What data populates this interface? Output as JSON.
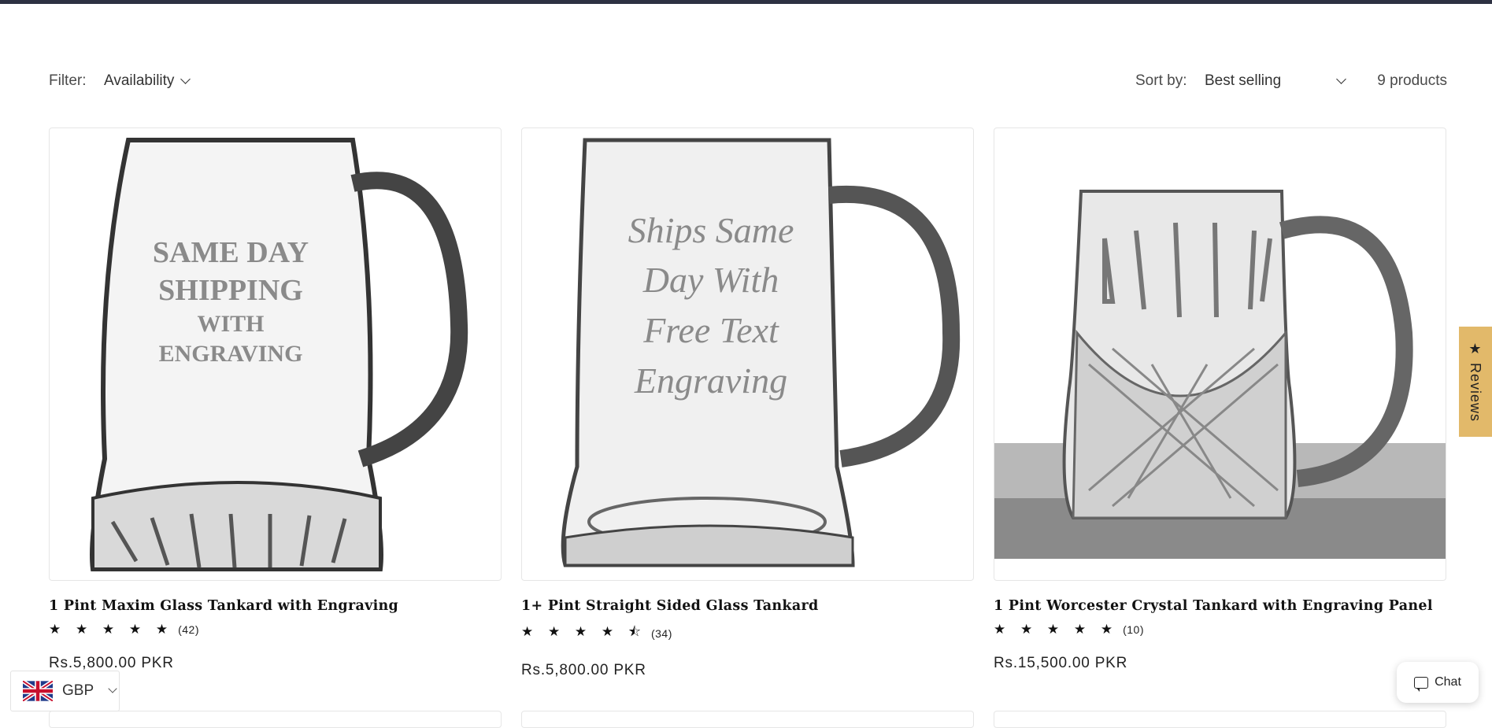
{
  "filter": {
    "label": "Filter:",
    "availability": "Availability"
  },
  "sort": {
    "label": "Sort by:",
    "selected": "Best selling"
  },
  "product_count": "9 products",
  "products": [
    {
      "title": "1 Pint Maxim Glass Tankard with Engraving",
      "stars": "★ ★ ★ ★ ★",
      "rating": 5,
      "review_count": "(42)",
      "price": "Rs.5,800.00 PKR"
    },
    {
      "title": "1+ Pint Straight Sided Glass Tankard",
      "stars": "★ ★ ★ ★ ⯪",
      "rating": 4.5,
      "review_count": "(34)",
      "price": "Rs.5,800.00 PKR"
    },
    {
      "title": "1 Pint Worcester Crystal Tankard with Engraving Panel",
      "stars": "★ ★ ★ ★ ★",
      "rating": 5,
      "review_count": "(10)",
      "price": "Rs.15,500.00 PKR"
    }
  ],
  "engraving": {
    "p1_l1": "SAME DAY",
    "p1_l2": "SHIPPING",
    "p1_l3": "WITH",
    "p1_l4": "ENGRAVING",
    "p2_l1": "Ships Same",
    "p2_l2": "Day With",
    "p2_l3": "Free Text",
    "p2_l4": "Engraving"
  },
  "reviews_tab": "★ Reviews",
  "chat": {
    "label": "Chat"
  },
  "currency": {
    "code": "GBP"
  },
  "colors": {
    "topbar": "#2d3142",
    "reviews_tab": "#e2b96a"
  }
}
